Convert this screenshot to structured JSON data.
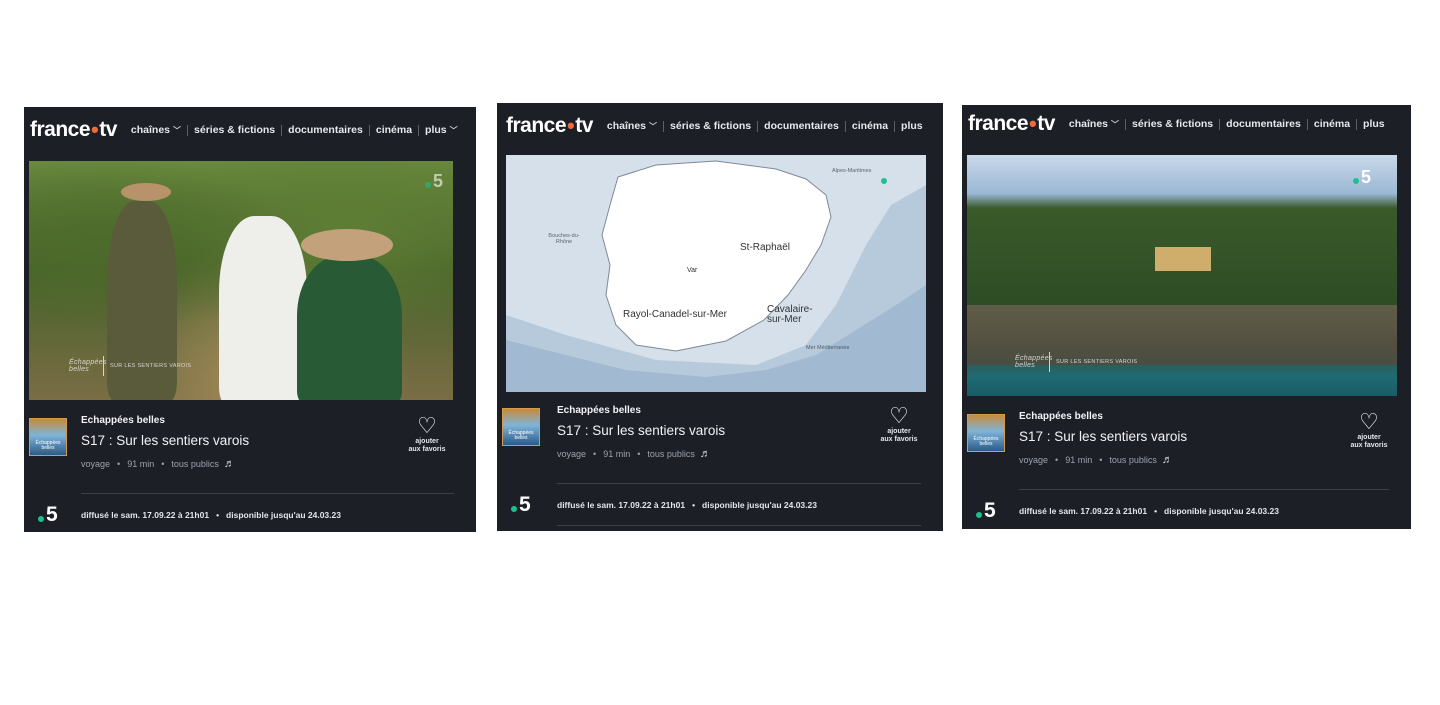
{
  "screens": [
    {
      "header": {
        "logo_left": "france",
        "logo_dot": "•",
        "logo_right": "tv",
        "nav": [
          {
            "label": "chaînes",
            "dropdown": true
          },
          {
            "label": "séries & fictions"
          },
          {
            "label": "documentaires"
          },
          {
            "label": "cinéma"
          },
          {
            "label": "plus",
            "dropdown": true
          }
        ]
      },
      "media": {
        "kind": "photo",
        "watermark_brand": "Échappées belles",
        "watermark_text": "SUR LES SENTIERS VAROIS"
      },
      "program_title": "Echappées belles",
      "episode_title": "S17 : Sur les sentiers varois",
      "meta": {
        "genre": "voyage",
        "duration": "91 min",
        "audience": "tous publics",
        "sep": "•"
      },
      "favorite": {
        "line1": "ajouter",
        "line2": "aux favoris"
      },
      "thumb_label": "Échappées belles",
      "channel": "5",
      "footer": {
        "broadcast": "diffusé le sam. 17.09.22 à 21h01",
        "availability": "disponible jusqu'au 24.03.23",
        "sep": "•"
      }
    },
    {
      "header": {
        "logo_left": "france",
        "logo_dot": "•",
        "logo_right": "tv",
        "nav": [
          {
            "label": "chaînes",
            "dropdown": true
          },
          {
            "label": "séries & fictions"
          },
          {
            "label": "documentaires"
          },
          {
            "label": "cinéma"
          },
          {
            "label": "plus"
          }
        ]
      },
      "media": {
        "kind": "map",
        "labels": {
          "alpes": "Alpes-Maritimes",
          "bouches": "Bouches-du-Rhône",
          "var": "Var",
          "st_raphael": "St-Raphaël",
          "rayol": "Rayol-Canadel-sur-Mer",
          "cavalaire_1": "Cavalaire-",
          "cavalaire_2": "sur-Mer",
          "mer": "Mer Méditerranée"
        }
      },
      "program_title": "Echappées belles",
      "episode_title": "S17 : Sur les sentiers varois",
      "meta": {
        "genre": "voyage",
        "duration": "91 min",
        "audience": "tous publics",
        "sep": "•"
      },
      "favorite": {
        "line1": "ajouter",
        "line2": "aux favoris"
      },
      "thumb_label": "Échappées belles",
      "channel": "5",
      "footer": {
        "broadcast": "diffusé le sam. 17.09.22 à 21h01",
        "availability": "disponible jusqu'au 24.03.23",
        "sep": "•"
      }
    },
    {
      "header": {
        "logo_left": "france",
        "logo_dot": "•",
        "logo_right": "tv",
        "nav": [
          {
            "label": "chaînes",
            "dropdown": true
          },
          {
            "label": "séries & fictions"
          },
          {
            "label": "documentaires"
          },
          {
            "label": "cinéma"
          },
          {
            "label": "plus"
          }
        ]
      },
      "media": {
        "kind": "coast",
        "watermark_brand": "Échappées belles",
        "watermark_text": "SUR LES SENTIERS VAROIS"
      },
      "program_title": "Echappées belles",
      "episode_title": "S17 : Sur les sentiers varois",
      "meta": {
        "genre": "voyage",
        "duration": "91 min",
        "audience": "tous publics",
        "sep": "•"
      },
      "favorite": {
        "line1": "ajouter",
        "line2": "aux favoris"
      },
      "thumb_label": "Échappées belles",
      "channel": "5",
      "footer": {
        "broadcast": "diffusé le sam. 17.09.22 à 21h01",
        "availability": "disponible jusqu'au 24.03.23",
        "sep": "•"
      }
    }
  ],
  "icons": {
    "heart": "heart-outline-icon",
    "chevron": "chevron-down-icon",
    "audio_description": "audio-description-icon",
    "channel_dot": "channel-dot-icon"
  },
  "colors": {
    "panel_bg": "#1c1f26",
    "logo_dot": "#f06a3b",
    "channel_green": "#1ac18c"
  }
}
